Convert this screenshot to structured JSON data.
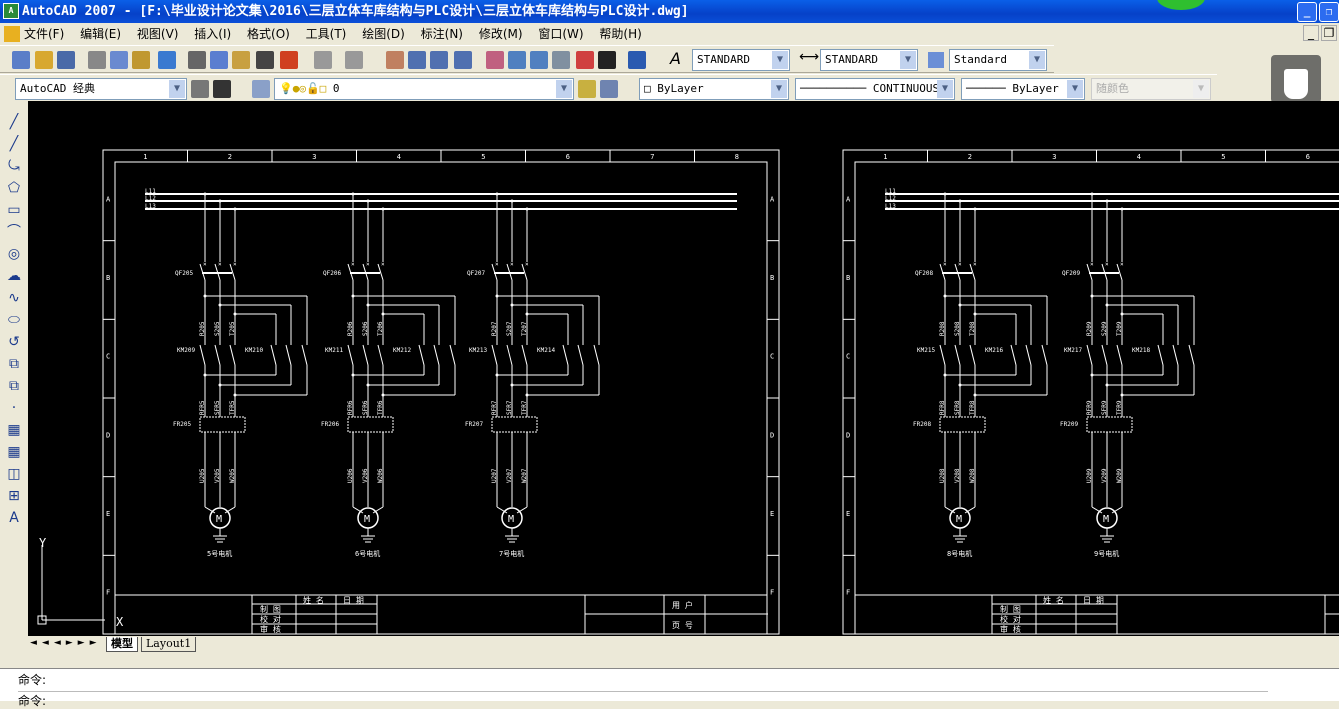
{
  "window": {
    "title": "AutoCAD 2007 - [F:\\毕业设计论文集\\2016\\三层立体车库结构与PLC设计\\三层立体车库结构与PLC设计.dwg]",
    "app_icon": "A"
  },
  "menu": [
    "文件(F)",
    "编辑(E)",
    "视图(V)",
    "插入(I)",
    "格式(O)",
    "工具(T)",
    "绘图(D)",
    "标注(N)",
    "修改(M)",
    "窗口(W)",
    "帮助(H)"
  ],
  "toolbar_styles": {
    "text_style": "STANDARD",
    "dim_style": "STANDARD",
    "table_style": "Standard"
  },
  "toolbar_layers": {
    "workspace": "AutoCAD 经典",
    "layer": "0",
    "color": "ByLayer",
    "linetype": "CONTINUOUS",
    "lineweight": "ByLayer",
    "plotstyle": "随颜色"
  },
  "tabs": [
    "模型",
    "Layout1"
  ],
  "command": {
    "prompt1": "命令:",
    "prompt2": "命令:"
  },
  "ucs": {
    "x": "X",
    "y": "Y"
  },
  "drawing": {
    "columns": [
      "1",
      "2",
      "3",
      "4",
      "5",
      "6",
      "7",
      "8"
    ],
    "rows": [
      "A",
      "B",
      "C",
      "D",
      "E",
      "F"
    ],
    "bus": [
      "L11",
      "L12",
      "L13"
    ],
    "title_block": {
      "name": "姓 名",
      "date": "日 期",
      "drawn": "制 图",
      "checked": "校 对",
      "reviewed": "审 核",
      "user": "用 户",
      "page": "页 号"
    },
    "circuits": [
      {
        "qf": "QF205",
        "km1": "KM209",
        "km2": "KM210",
        "wires": [
          "R205",
          "S205",
          "T205"
        ],
        "fr": "FR205",
        "frw": [
          "RFR5",
          "SFR5",
          "TFR5"
        ],
        "mw": [
          "U205",
          "V205",
          "W205"
        ],
        "motor": "M",
        "name": "5号电机"
      },
      {
        "qf": "QF206",
        "km1": "KM211",
        "km2": "KM212",
        "wires": [
          "R206",
          "S206",
          "T206"
        ],
        "fr": "FR206",
        "frw": [
          "RFR6",
          "SFR6",
          "TFR6"
        ],
        "mw": [
          "U206",
          "V206",
          "W206"
        ],
        "motor": "M",
        "name": "6号电机"
      },
      {
        "qf": "QF207",
        "km1": "KM213",
        "km2": "KM214",
        "wires": [
          "R207",
          "S207",
          "T207"
        ],
        "fr": "FR207",
        "frw": [
          "RFR7",
          "SFR7",
          "TFR7"
        ],
        "mw": [
          "U207",
          "V207",
          "W207"
        ],
        "motor": "M",
        "name": "7号电机"
      },
      {
        "qf": "QF208",
        "km1": "KM215",
        "km2": "KM216",
        "wires": [
          "R208",
          "S208",
          "T208"
        ],
        "fr": "FR208",
        "frw": [
          "RFR8",
          "SFR8",
          "TFR8"
        ],
        "mw": [
          "U208",
          "V208",
          "W208"
        ],
        "motor": "M",
        "name": "8号电机"
      },
      {
        "qf": "QF209",
        "km1": "KM217",
        "km2": "KM218",
        "wires": [
          "R209",
          "S209",
          "T209"
        ],
        "fr": "FR209",
        "frw": [
          "RFR9",
          "SFR9",
          "TFR9"
        ],
        "mw": [
          "U209",
          "V209",
          "W209"
        ],
        "motor": "M",
        "name": "9号电机"
      }
    ]
  }
}
